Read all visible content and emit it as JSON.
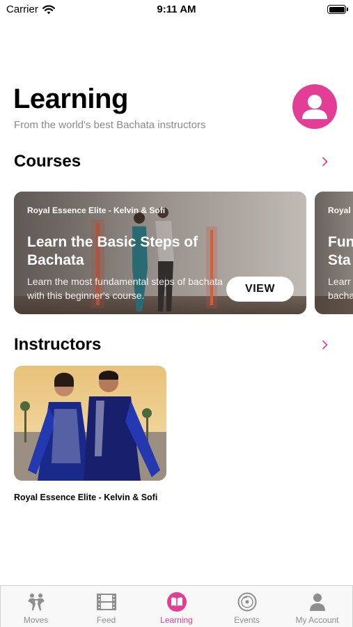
{
  "status_bar": {
    "carrier": "Carrier",
    "time": "9:11 AM"
  },
  "header": {
    "title": "Learning",
    "subtitle": "From the world's best Bachata instructors",
    "avatar_icon": "user-avatar-icon"
  },
  "courses": {
    "title": "Courses",
    "items": [
      {
        "instructor": "Royal Essence Elite - Kelvin & Sofi",
        "title": "Learn the Basic Steps of Bachata",
        "description": "Learn the most fundamental steps of bachata with this beginner's course.",
        "button_label": "VIEW"
      },
      {
        "instructor": "Royal",
        "title": "Fun Sta",
        "description": "Learr bacha"
      }
    ]
  },
  "instructors": {
    "title": "Instructors",
    "items": [
      {
        "name": "Royal Essence Elite - Kelvin & Sofi"
      }
    ]
  },
  "tab_bar": {
    "tabs": [
      {
        "label": "Moves",
        "icon": "dancers-icon"
      },
      {
        "label": "Feed",
        "icon": "film-icon"
      },
      {
        "label": "Learning",
        "icon": "book-icon",
        "active": true
      },
      {
        "label": "Events",
        "icon": "disc-icon"
      },
      {
        "label": "My Account",
        "icon": "person-icon"
      }
    ]
  },
  "colors": {
    "accent": "#e33e96",
    "inactive": "#8e8e8e"
  }
}
